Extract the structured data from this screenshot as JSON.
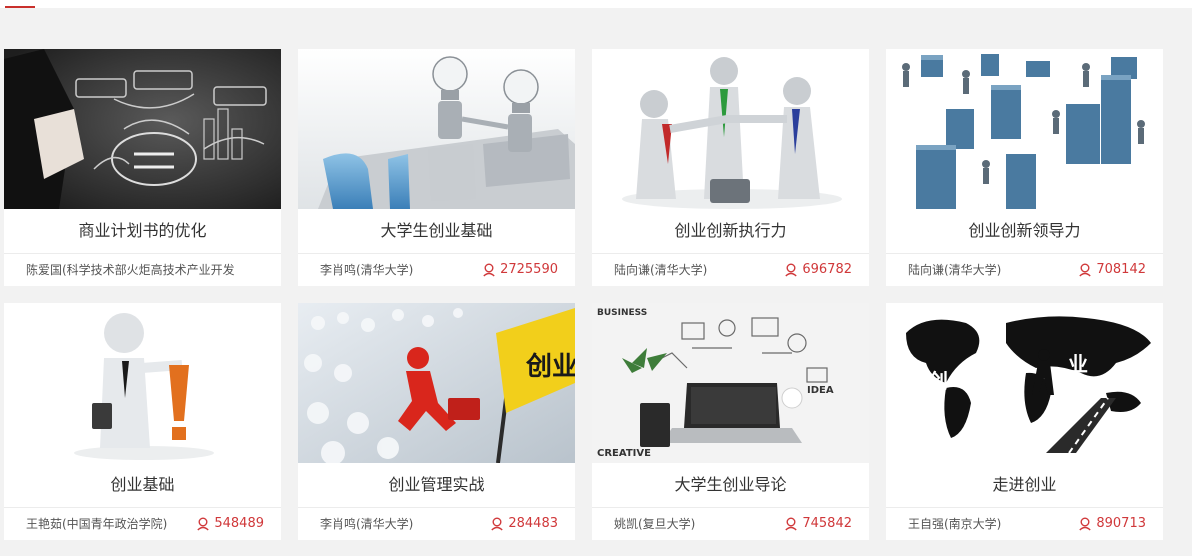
{
  "courses": [
    {
      "title": "商业计划书的优化",
      "author": "陈爱国(科学技术部火炬高技术产业开发",
      "views": "",
      "icon": "business-strategy-chalkboard-image"
    },
    {
      "title": "大学生创业基础",
      "author": "李肖鸣(清华大学)",
      "views": "2725590",
      "icon": "business-lightbulb-robots-image"
    },
    {
      "title": "创业创新执行力",
      "author": "陆向谦(清华大学)",
      "views": "696782",
      "icon": "three-figures-joining-hands-image"
    },
    {
      "title": "创业创新领导力",
      "author": "陆向谦(清华大学)",
      "views": "708142",
      "icon": "business-people-on-blocks-image"
    },
    {
      "title": "创业基础",
      "author": "王艳茹(中国青年政治学院)",
      "views": "548489",
      "icon": "figure-with-exclamation-image"
    },
    {
      "title": "创业管理实战",
      "author": "李肖鸣(清华大学)",
      "views": "284483",
      "icon": "red-runner-chuangye-sign-image"
    },
    {
      "title": "大学生创业导论",
      "author": "姚凯(复旦大学)",
      "views": "745842",
      "icon": "laptop-business-doodles-image"
    },
    {
      "title": "走进创业",
      "author": "王自强(南京大学)",
      "views": "890713",
      "icon": "world-map-walking-man-image"
    }
  ],
  "colors": {
    "accent": "#c9302c",
    "views": "#d0383a",
    "background": "#f2f2f2",
    "card": "#ffffff"
  }
}
